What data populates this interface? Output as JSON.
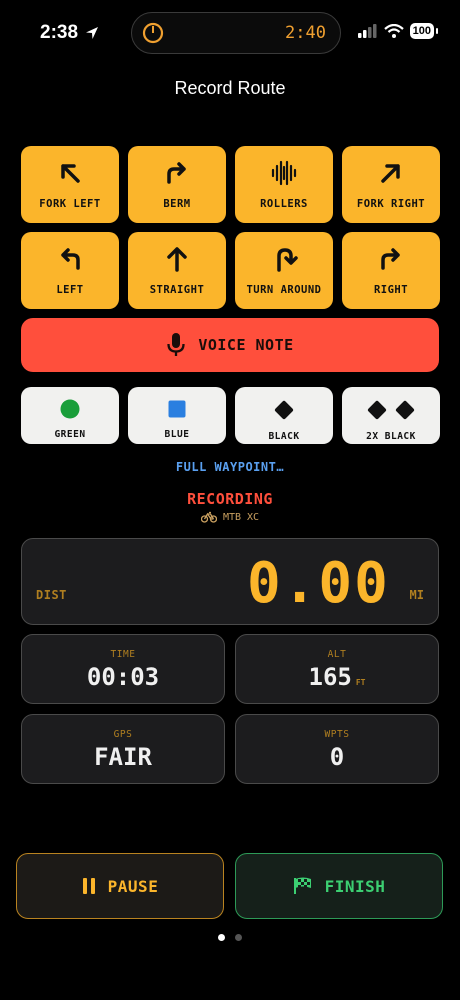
{
  "status": {
    "time": "2:38",
    "island_time": "2:40",
    "battery": "100"
  },
  "title": "Record Route",
  "directions": [
    {
      "label": "FORK LEFT",
      "icon": "arrow-up-left-icon"
    },
    {
      "label": "BERM",
      "icon": "arrow-turn-right-icon"
    },
    {
      "label": "ROLLERS",
      "icon": "waveform-icon"
    },
    {
      "label": "FORK RIGHT",
      "icon": "arrow-up-right-icon"
    },
    {
      "label": "LEFT",
      "icon": "arrow-turn-left-icon"
    },
    {
      "label": "STRAIGHT",
      "icon": "arrow-up-icon"
    },
    {
      "label": "TURN AROUND",
      "icon": "u-turn-icon"
    },
    {
      "label": "RIGHT",
      "icon": "arrow-turn-right-icon"
    }
  ],
  "voice_note": {
    "label": "VOICE NOTE",
    "icon": "microphone-icon"
  },
  "difficulty": [
    {
      "label": "GREEN",
      "icon": "green-circle-icon",
      "color": "#1a9e3a"
    },
    {
      "label": "BLUE",
      "icon": "blue-square-icon",
      "color": "#2a7fe0"
    },
    {
      "label": "BLACK",
      "icon": "black-diamond-icon",
      "color": "#111111"
    },
    {
      "label": "2X BLACK",
      "icon": "double-black-diamond-icon",
      "color": "#111111"
    }
  ],
  "waypoint_link": "FULL WAYPOINT…",
  "recording": {
    "status": "RECORDING",
    "activity": "MTB XC",
    "icon": "bicycle-icon"
  },
  "distance": {
    "label": "DIST",
    "value": "0.00",
    "unit": "MI"
  },
  "stats": {
    "time": {
      "label": "TIME",
      "value": "00:03"
    },
    "alt": {
      "label": "ALT",
      "value": "165",
      "unit": "FT"
    },
    "gps": {
      "label": "GPS",
      "value": "FAIR"
    },
    "wpts": {
      "label": "WPTS",
      "value": "0"
    }
  },
  "actions": {
    "pause": "PAUSE",
    "finish": "FINISH"
  },
  "colors": {
    "accent": "#fbb52b",
    "danger": "#ff4f3c",
    "success": "#3ccf72",
    "link": "#5aa0f0"
  },
  "page_indicator": {
    "current": 1,
    "total": 2
  }
}
